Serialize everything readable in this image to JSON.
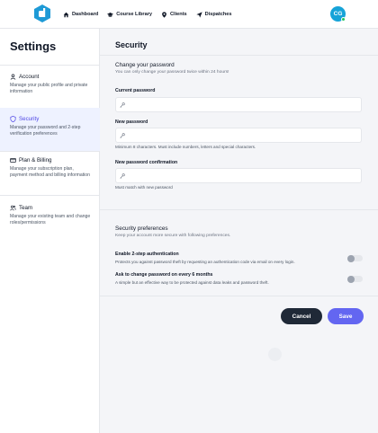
{
  "nav": {
    "links": [
      {
        "label": "Dashboard",
        "icon": "home-icon"
      },
      {
        "label": "Course Library",
        "icon": "graduation-cap-icon"
      },
      {
        "label": "Clients",
        "icon": "map-pin-icon"
      },
      {
        "label": "Dispatches",
        "icon": "send-icon"
      }
    ],
    "avatar_initials": "CG",
    "colors": {
      "logo": "#1e9ad6",
      "avatar": "#16a3d8",
      "online": "#22c55e"
    }
  },
  "sidebar": {
    "title": "Settings",
    "items": [
      {
        "label": "Account",
        "desc": "Manage your public profile and private information",
        "icon": "user-icon"
      },
      {
        "label": "Security",
        "desc": "Manage your password and 2-step verification preferences",
        "icon": "shield-icon",
        "active": true
      },
      {
        "label": "Plan & Billing",
        "desc": "Manage your subscription plan, payment method and billing information",
        "icon": "credit-card-icon"
      },
      {
        "label": "Team",
        "desc": "Manage your existing team and change roles/permissions",
        "icon": "users-icon"
      }
    ]
  },
  "main": {
    "title": "Security",
    "password": {
      "title": "Change your password",
      "desc": "You can only change your password twice within 24 hours!",
      "current_label": "Current password",
      "new_label": "New password",
      "new_hint": "Minimum 8 characters. Must include numbers, letters and special characters.",
      "confirm_label": "New password confirmation",
      "confirm_hint": "Must match with new password",
      "current_value": "",
      "new_value": "",
      "confirm_value": ""
    },
    "preferences": {
      "title": "Security preferences",
      "desc": "Keep your account more secure with following preferences.",
      "items": [
        {
          "label": "Enable 2-step authentication",
          "desc": "Protects you against password theft by requesting an authentication code via email on every login.",
          "enabled": false
        },
        {
          "label": "Ask to change password on every 6 months",
          "desc": "A simple but an effective way to be protected against data leaks and password theft.",
          "enabled": false
        }
      ]
    },
    "buttons": {
      "cancel": "Cancel",
      "save": "Save"
    },
    "colors": {
      "accent": "#6366f1",
      "cancel_bg": "#1f2937",
      "active_bg": "#eef2ff"
    }
  }
}
